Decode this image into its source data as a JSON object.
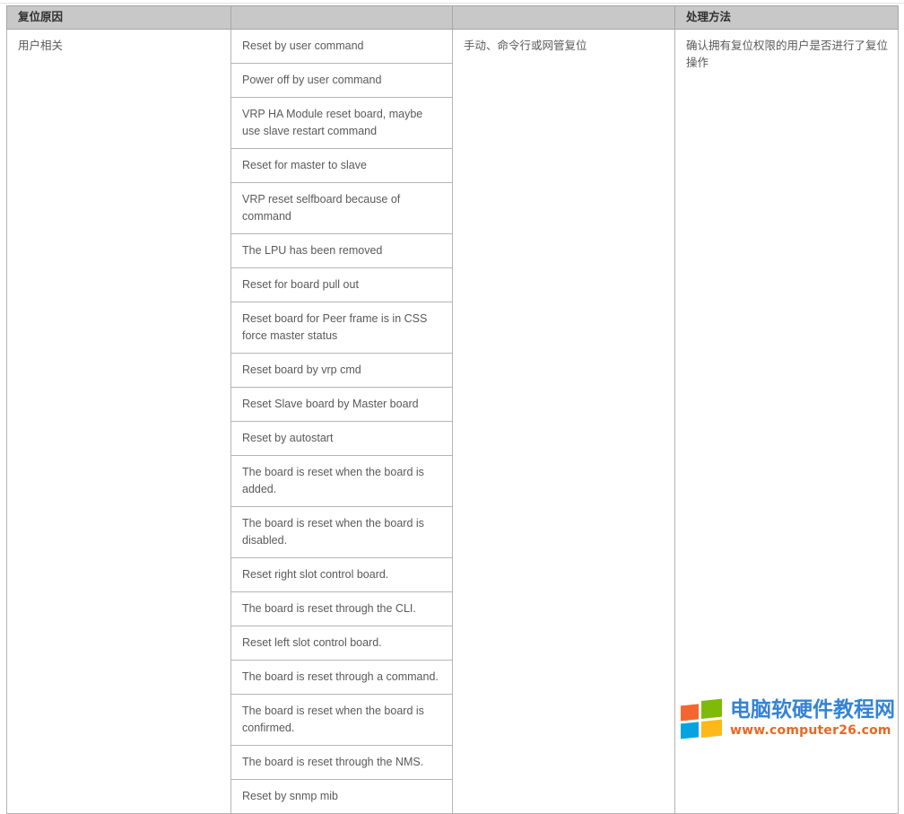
{
  "table": {
    "headers": {
      "reason": "复位原因",
      "detail": "",
      "description": "",
      "method": "处理方法"
    },
    "reason_group": "用户相关",
    "description": "手动、命令行或网管复位",
    "method": "确认拥有复位权限的用户是否进行了复位操作",
    "detail_rows": [
      "Reset by user command",
      "Power off by user command",
      "VRP HA Module reset board, maybe use slave restart command",
      "Reset for master to slave",
      "VRP reset selfboard because of command",
      "The LPU has been removed",
      "Reset for board pull out",
      "Reset board for Peer frame is in CSS force master status",
      "Reset board by vrp cmd",
      "Reset Slave board by Master board",
      "Reset by autostart",
      "The board is reset when the board is added.",
      "The board is reset when the board is disabled.",
      "Reset right slot control board.",
      "The board is reset through the CLI.",
      "Reset left slot control board.",
      "The board is reset through a command.",
      "The board is reset when the board is confirmed.",
      "The board is reset through the NMS.",
      "Reset by snmp mib"
    ]
  },
  "watermark": {
    "title": "电脑软硬件教程网",
    "url": "www.computer26.com",
    "colors": {
      "tile_top_left": "#f4622a",
      "tile_top_right": "#7ab800",
      "tile_bottom_left": "#00a1e0",
      "tile_bottom_right": "#fcb711",
      "title_color": "#2f7fd4",
      "url_color": "#e8641c"
    }
  },
  "style": {
    "header_background": "#c8c8c8",
    "border_color": "#b5b5b5",
    "text_color": "#5a5a5a"
  }
}
